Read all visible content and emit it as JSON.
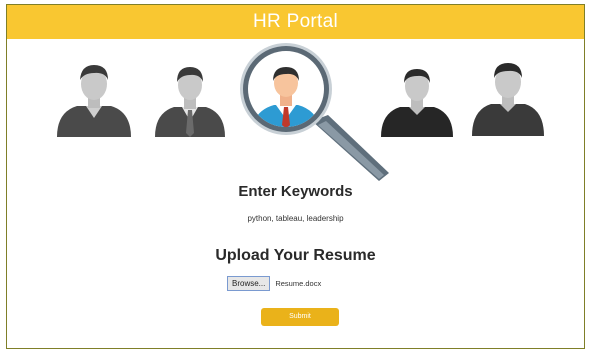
{
  "header": {
    "title": "HR Portal"
  },
  "keywords": {
    "heading": "Enter Keywords",
    "value": "python, tableau, leadership"
  },
  "resume": {
    "heading": "Upload Your Resume",
    "browse_label": "Browse...",
    "file_name": "Resume.docx"
  },
  "submit": {
    "label": "Submit"
  },
  "colors": {
    "header_bg": "#f9c731",
    "submit_bg": "#eab21a",
    "frame_border": "#7f7f28"
  },
  "icons": [
    "person-icon",
    "person-tie-icon",
    "magnifier-person-icon",
    "person-icon",
    "person-icon"
  ]
}
